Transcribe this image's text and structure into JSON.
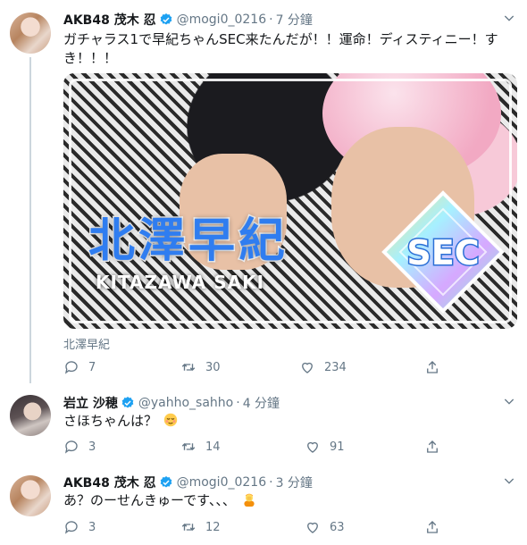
{
  "tweets": [
    {
      "name": "AKB48 茂木 忍",
      "handle": "@mogi0_0216",
      "time": "7 分鐘",
      "text_line1": "ガチャラス1で早紀ちゃんSEC来たんだが！！運命！ディスティニー！す",
      "text_line2": "き！！！",
      "media": {
        "name_jp": "北澤早紀",
        "name_en": "KITAZAWA SAKI",
        "badge": "SEC"
      },
      "caption": "北澤早紀",
      "replies": "7",
      "retweets": "30",
      "likes": "234"
    },
    {
      "name": "岩立 沙穂",
      "handle": "@yahho_sahho",
      "time": "4 分鐘",
      "text": "さほちゃんは？",
      "replies": "3",
      "retweets": "14",
      "likes": "91"
    },
    {
      "name": "AKB48 茂木 忍",
      "handle": "@mogi0_0216",
      "time": "3 分鐘",
      "text": "あ？のーせんきゅーです、、、",
      "replies": "3",
      "retweets": "12",
      "likes": "63"
    }
  ],
  "icons": [
    "verified-icon",
    "chevron-down-icon",
    "reply-icon",
    "retweet-icon",
    "like-icon",
    "share-icon"
  ],
  "colors": {
    "verified": "#1da1f2",
    "muted": "#657786",
    "text": "#14171a"
  }
}
